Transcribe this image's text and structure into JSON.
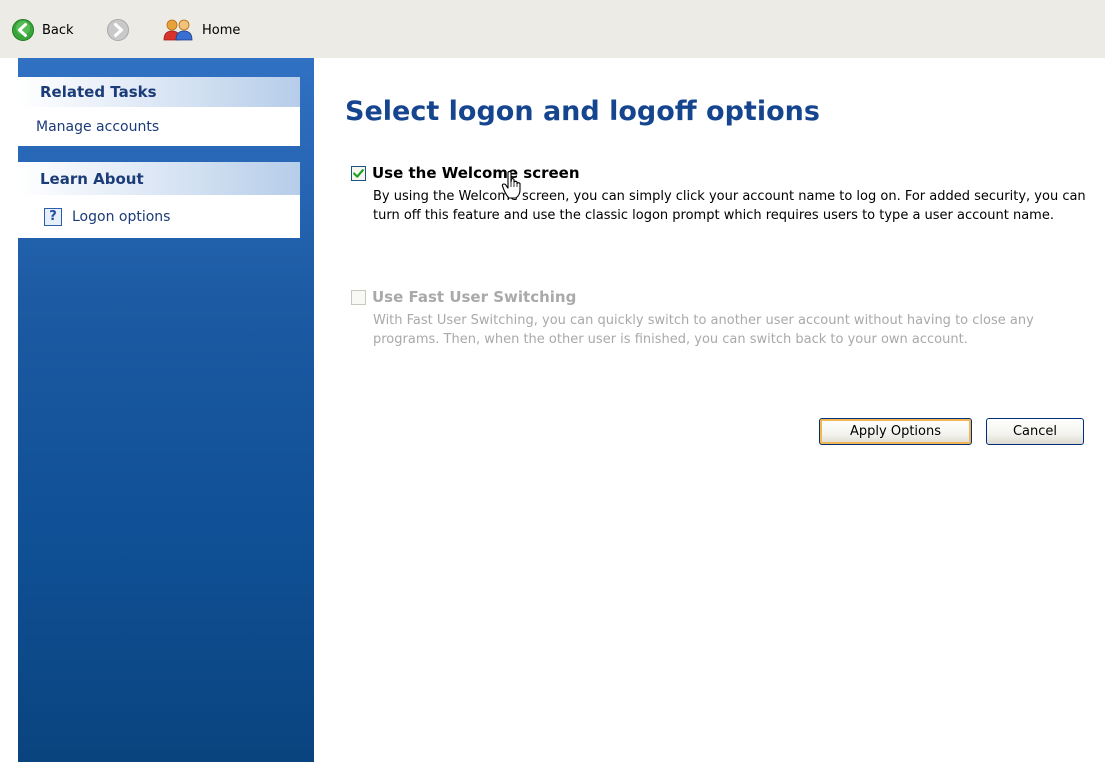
{
  "toolbar": {
    "back_label": "Back",
    "home_label": "Home",
    "icons": {
      "back": "back-arrow-icon",
      "forward": "forward-arrow-icon",
      "home": "users-home-icon"
    },
    "colors": {
      "back_active": "#3aa63a",
      "forward_disabled": "#b9b9b9"
    }
  },
  "sidebar": {
    "related_tasks": {
      "title": "Related Tasks",
      "links": [
        "Manage accounts"
      ]
    },
    "learn_about": {
      "title": "Learn About",
      "links": [
        "Logon options"
      ],
      "icon": "help-icon"
    },
    "colors": {
      "background_top": "#3171c3",
      "background_bottom": "#0a447f"
    }
  },
  "main": {
    "title": "Select logon and logoff options",
    "options": [
      {
        "label": "Use the Welcome screen",
        "checked": true,
        "enabled": true,
        "description": "By using the Welcome screen, you can simply click your account name to log on. For added security, you can turn off this feature and use the classic logon prompt which requires users to type a user account name."
      },
      {
        "label": "Use Fast User Switching",
        "checked": false,
        "enabled": false,
        "description": "With Fast User Switching, you can quickly switch to another user account without having to close any programs. Then, when the other user is finished, you can switch back to your own account."
      }
    ],
    "buttons": {
      "apply": "Apply Options",
      "cancel": "Cancel"
    },
    "colors": {
      "title": "#16458f",
      "checkmark": "#21a121",
      "disabled_text": "#a9a9a9"
    }
  }
}
